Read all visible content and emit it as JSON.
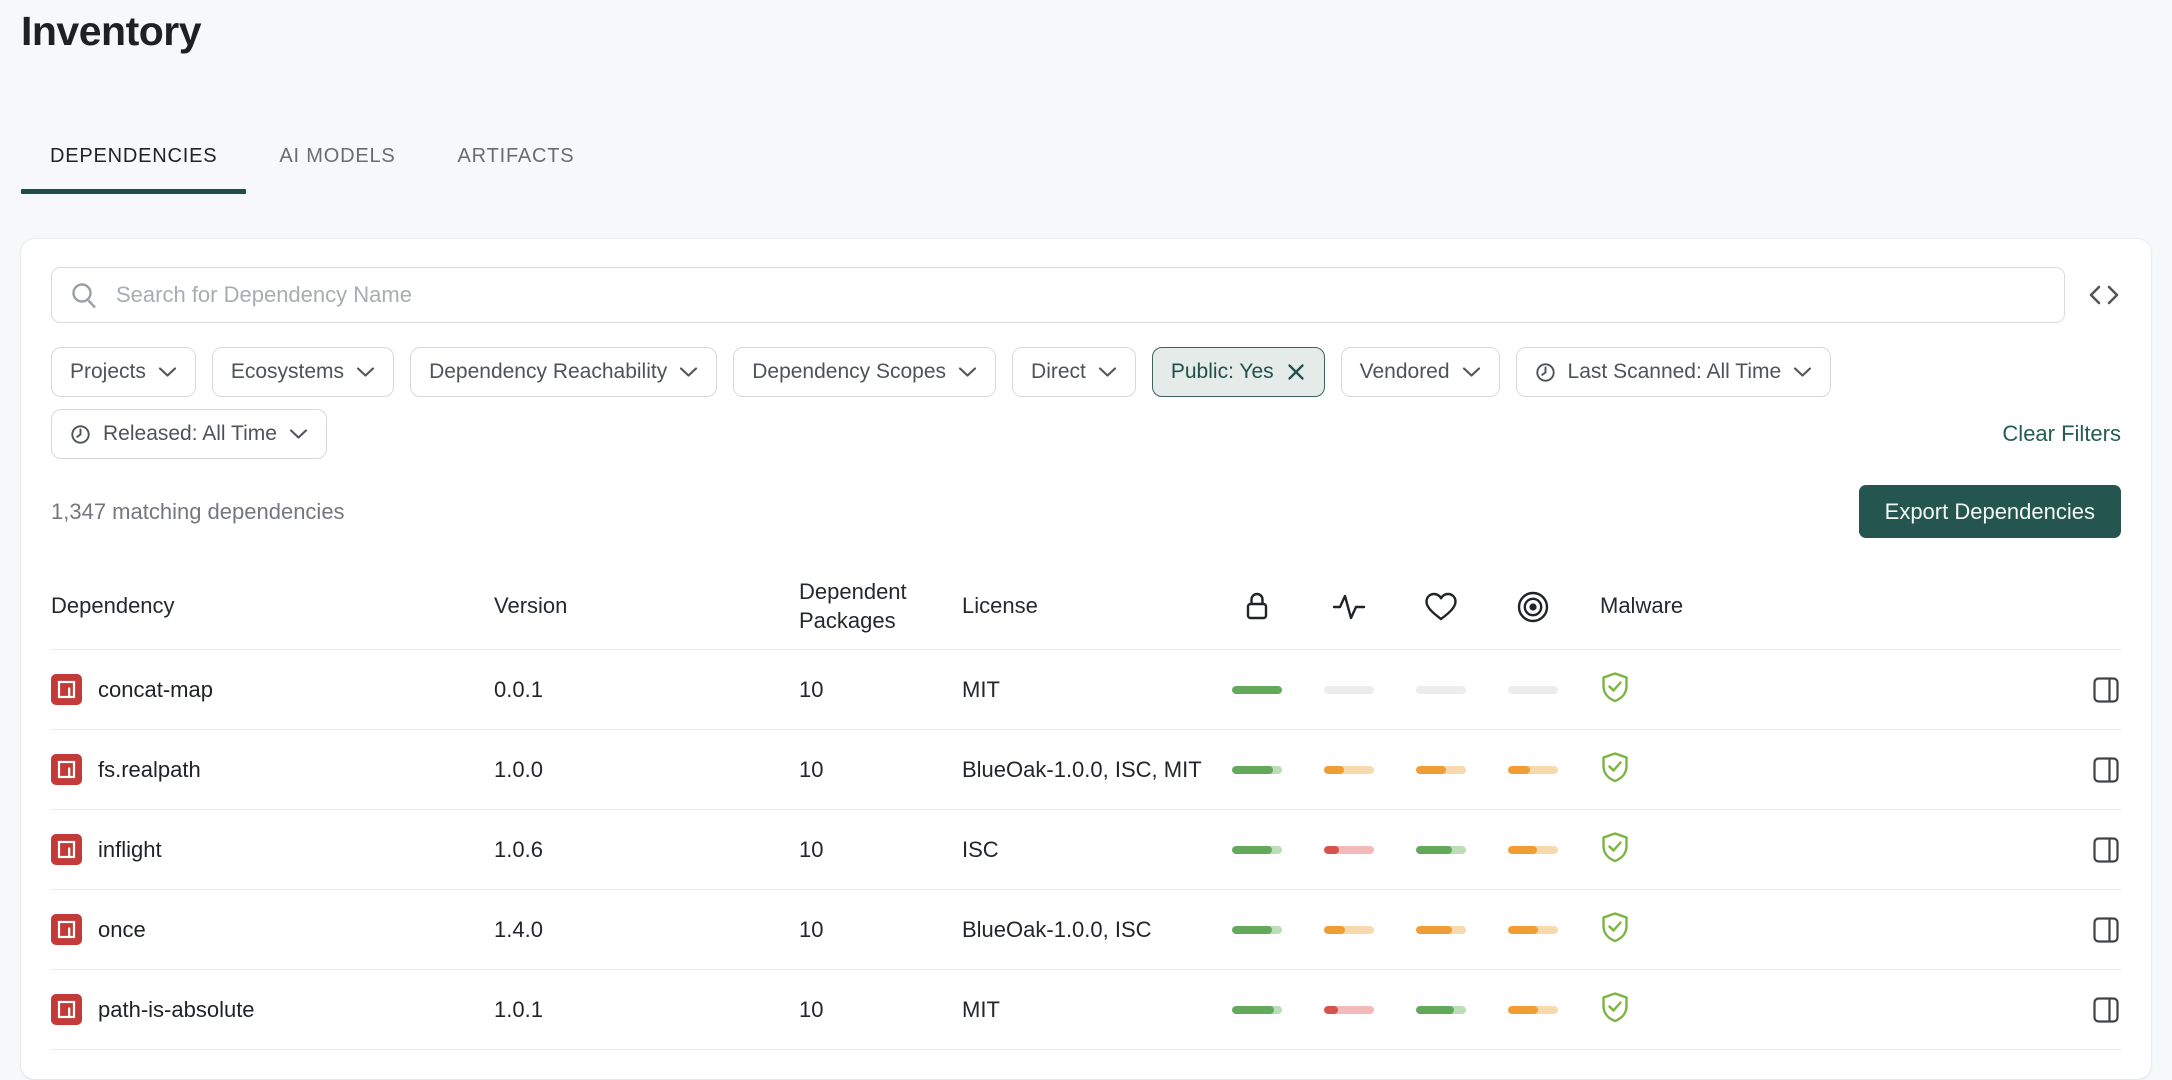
{
  "page": {
    "title": "Inventory"
  },
  "tabs": [
    {
      "label": "DEPENDENCIES",
      "active": true
    },
    {
      "label": "AI MODELS",
      "active": false
    },
    {
      "label": "ARTIFACTS",
      "active": false
    }
  ],
  "search": {
    "placeholder": "Search for Dependency Name"
  },
  "filters": {
    "rows": [
      [
        {
          "label": "Projects",
          "type": "dropdown"
        },
        {
          "label": "Ecosystems",
          "type": "dropdown"
        },
        {
          "label": "Dependency Reachability",
          "type": "dropdown"
        },
        {
          "label": "Dependency Scopes",
          "type": "dropdown"
        },
        {
          "label": "Direct",
          "type": "dropdown"
        },
        {
          "label": "Public: Yes",
          "type": "active-removable"
        },
        {
          "label": "Vendored",
          "type": "dropdown"
        },
        {
          "label": "Last Scanned: All Time",
          "type": "dropdown",
          "icon": "clock"
        }
      ],
      [
        {
          "label": "Released: All Time",
          "type": "dropdown",
          "icon": "clock"
        }
      ]
    ],
    "clear_label": "Clear Filters"
  },
  "summary": {
    "matching_text": "1,347 matching dependencies",
    "export_label": "Export Dependencies"
  },
  "table": {
    "headers": {
      "dependency": "Dependency",
      "version": "Version",
      "dependents": "Dependent Packages",
      "license": "License",
      "malware": "Malware"
    },
    "score_columns": [
      "security",
      "quality",
      "maintenance",
      "vulnerability"
    ],
    "rows": [
      {
        "name": "concat-map",
        "ecosystem": "npm",
        "version": "0.0.1",
        "dependents": "10",
        "license": "MIT",
        "scores": [
          {
            "pct": 100,
            "level": "green"
          },
          {
            "pct": 0,
            "level": "empty"
          },
          {
            "pct": 0,
            "level": "empty"
          },
          {
            "pct": 0,
            "level": "empty"
          }
        ],
        "malware": "safe"
      },
      {
        "name": "fs.realpath",
        "ecosystem": "npm",
        "version": "1.0.0",
        "dependents": "10",
        "license": "BlueOak-1.0.0, ISC, MIT",
        "scores": [
          {
            "pct": 82,
            "level": "green"
          },
          {
            "pct": 40,
            "level": "orange"
          },
          {
            "pct": 60,
            "level": "orange"
          },
          {
            "pct": 44,
            "level": "orange"
          }
        ],
        "malware": "safe"
      },
      {
        "name": "inflight",
        "ecosystem": "npm",
        "version": "1.0.6",
        "dependents": "10",
        "license": "ISC",
        "scores": [
          {
            "pct": 80,
            "level": "green"
          },
          {
            "pct": 30,
            "level": "red"
          },
          {
            "pct": 72,
            "level": "green"
          },
          {
            "pct": 58,
            "level": "orange"
          }
        ],
        "malware": "safe"
      },
      {
        "name": "once",
        "ecosystem": "npm",
        "version": "1.4.0",
        "dependents": "10",
        "license": "BlueOak-1.0.0, ISC",
        "scores": [
          {
            "pct": 80,
            "level": "green"
          },
          {
            "pct": 42,
            "level": "orange"
          },
          {
            "pct": 72,
            "level": "orange"
          },
          {
            "pct": 60,
            "level": "orange"
          }
        ],
        "malware": "safe"
      },
      {
        "name": "path-is-absolute",
        "ecosystem": "npm",
        "version": "1.0.1",
        "dependents": "10",
        "license": "MIT",
        "scores": [
          {
            "pct": 84,
            "level": "green"
          },
          {
            "pct": 28,
            "level": "red"
          },
          {
            "pct": 76,
            "level": "green"
          },
          {
            "pct": 60,
            "level": "orange"
          }
        ],
        "malware": "safe"
      }
    ]
  },
  "colors": {
    "accent_teal": "#24564f",
    "tab_underline": "#1d4e49",
    "score_green": "#63a95c",
    "score_orange": "#f09d35",
    "score_red": "#d8524d",
    "npm_red": "#c43a38",
    "shield_green": "#7cb342"
  }
}
